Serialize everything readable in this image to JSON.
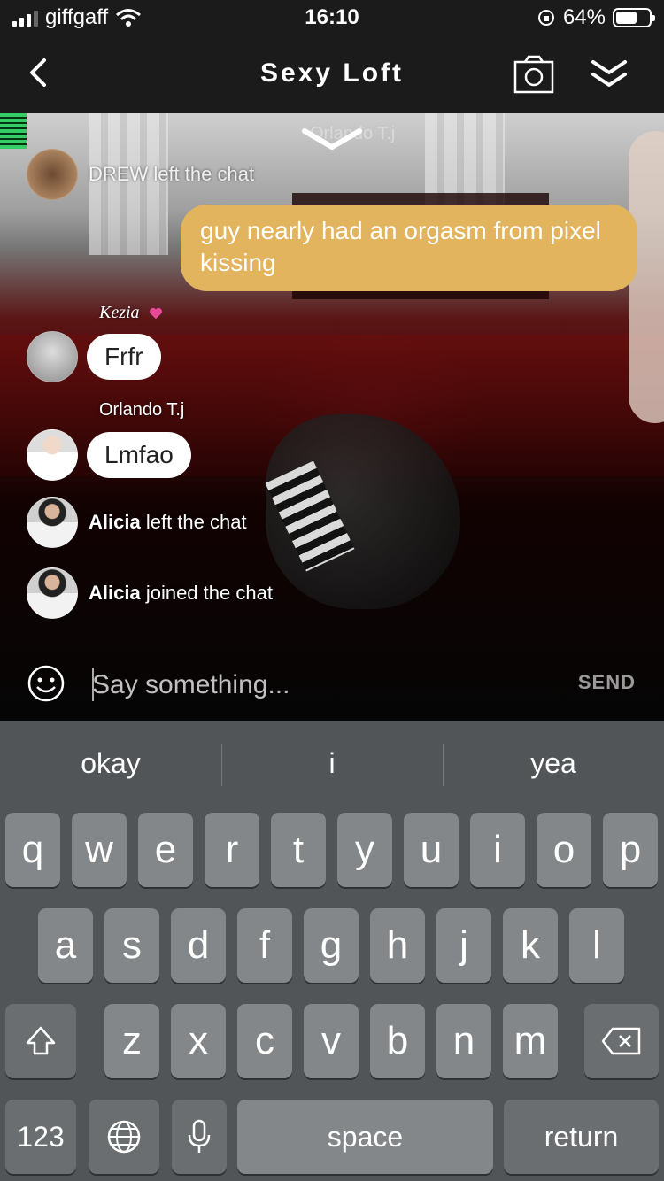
{
  "status_bar": {
    "carrier": "giffgaff",
    "time": "16:10",
    "battery": "64%",
    "battery_level": 0.64
  },
  "header": {
    "title": "Sexy Loft",
    "icons": [
      "chevron-left-icon",
      "camera-icon",
      "double-chevron-down-icon"
    ]
  },
  "scene": {
    "ghost_name": "Orlando T.j"
  },
  "chat": {
    "partial_line": "DREW left the chat",
    "my_message": "guy nearly had an orgasm from pixel kissing",
    "messages": [
      {
        "sender": "Kezia",
        "text": "Frfr"
      },
      {
        "sender": "Orlando T.j",
        "text": "Lmfao"
      }
    ],
    "events": [
      {
        "name": "Alicia",
        "action": "left the chat"
      },
      {
        "name": "Alicia",
        "action": "joined the chat"
      }
    ]
  },
  "composer": {
    "placeholder": "Say something...",
    "send_label": "SEND"
  },
  "keyboard": {
    "suggestions": [
      "okay",
      "i",
      "yea"
    ],
    "row1": [
      "q",
      "w",
      "e",
      "r",
      "t",
      "y",
      "u",
      "i",
      "o",
      "p"
    ],
    "row2": [
      "a",
      "s",
      "d",
      "f",
      "g",
      "h",
      "j",
      "k",
      "l"
    ],
    "row3": [
      "z",
      "x",
      "c",
      "v",
      "b",
      "n",
      "m"
    ],
    "numbers_label": "123",
    "space_label": "space",
    "return_label": "return"
  },
  "colors": {
    "header_bg": "#1b1b1b",
    "my_bubble": "#e3b45e",
    "keyboard_bg": "#515558",
    "key_bg": "#848789"
  }
}
